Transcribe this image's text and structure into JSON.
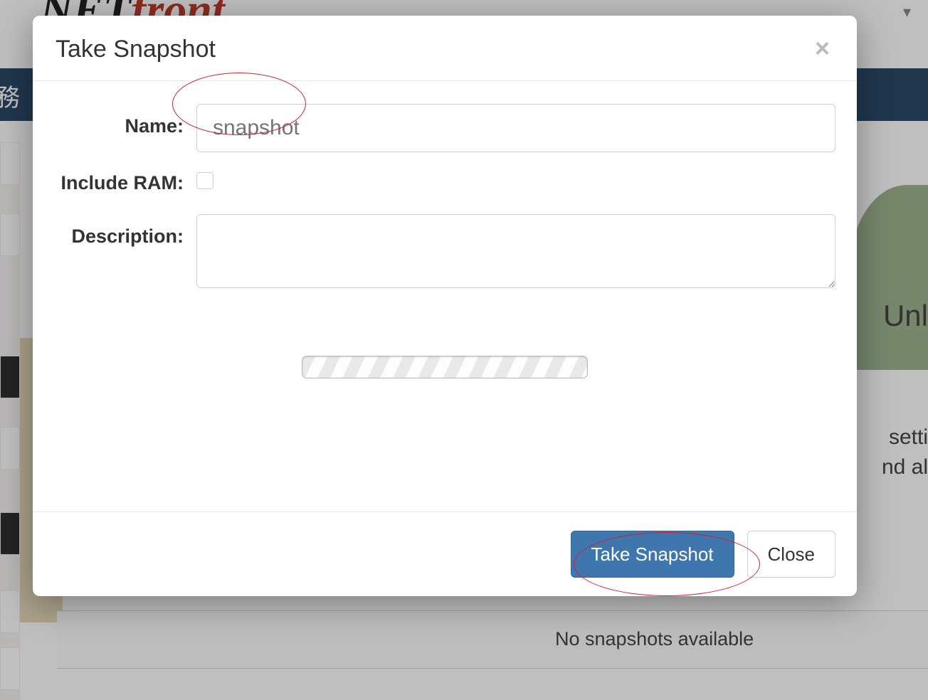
{
  "background": {
    "logo_black": "NET",
    "logo_red": "front",
    "nav_text": "務",
    "right_text_1": "Unl",
    "right_text_2": "setti",
    "right_text_3": "nd al",
    "snapshots_empty": "No snapshots available"
  },
  "modal": {
    "title": "Take Snapshot",
    "close_glyph": "×",
    "fields": {
      "name_label": "Name:",
      "name_placeholder": "snapshot",
      "name_value": "",
      "ram_label": "Include RAM:",
      "ram_checked": false,
      "desc_label": "Description:",
      "desc_value": ""
    },
    "buttons": {
      "primary": "Take Snapshot",
      "cancel": "Close"
    }
  }
}
